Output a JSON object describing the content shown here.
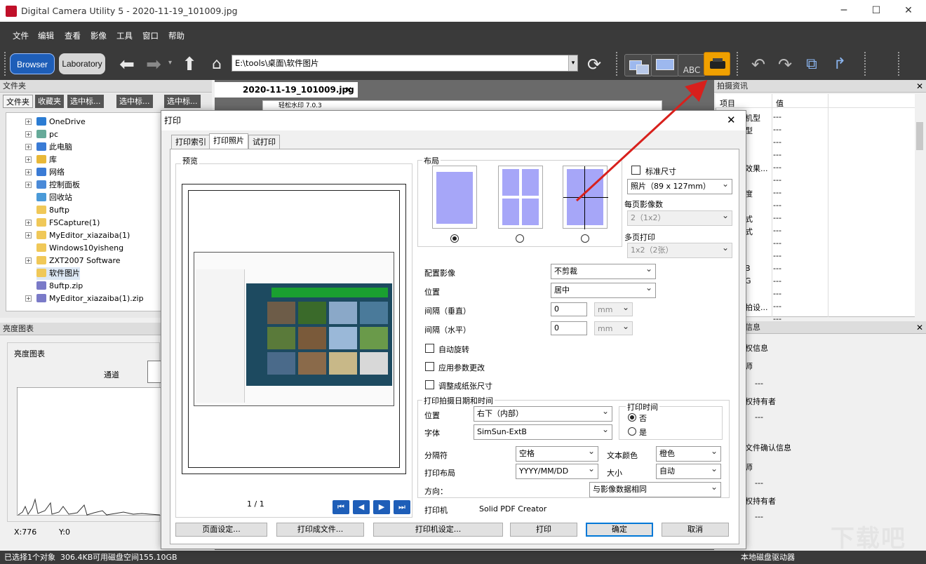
{
  "window": {
    "title": "Digital Camera Utility 5 - 2020-11-19_101009.jpg",
    "min": "─",
    "max": "☐",
    "close": "✕"
  },
  "menu": [
    "文件",
    "编辑",
    "查看",
    "影像",
    "工具",
    "窗口",
    "帮助"
  ],
  "toolbar": {
    "browser": "Browser",
    "laboratory": "Laboratory",
    "path": "E:\\tools\\桌面\\软件图片"
  },
  "left": {
    "folder_panel_title": "文件夹",
    "tabs": [
      "文件夹",
      "收藏夹",
      "选中标...",
      "选中标...",
      "选中标..."
    ],
    "tree": [
      "OneDrive",
      "pc",
      "此电脑",
      "库",
      "网络",
      "控制面板",
      "回收站",
      "8uftp",
      "FSCapture(1)",
      "MyEditor_xiazaiba(1)",
      "Windows10yisheng",
      "ZXT2007 Software",
      "软件图片",
      "8uftp.zip",
      "MyEditor_xiazaiba(1).zip"
    ],
    "brightness_title": "亮度图表",
    "brightness_group": "亮度图表",
    "channel": "通道",
    "x": "X:776",
    "y": "Y:0"
  },
  "doc_tab": "2020-11-19_101009.jpg",
  "background_window": "轻松水印 7.0.3",
  "right": {
    "panel1_title": "拍摄资讯",
    "col_item": "项目",
    "col_value": "值",
    "partial_items": [
      "机型",
      "型",
      "效果...",
      "度",
      "式",
      "式",
      "B",
      "G",
      "拍设..."
    ],
    "dash": "---",
    "panel2_title": "信息",
    "p2_items": [
      "权信息",
      "师",
      "---",
      "权持有者",
      "---",
      "文件确认信息",
      "师",
      "---",
      "权持有者",
      "---"
    ]
  },
  "dialog": {
    "title": "打印",
    "close": "✕",
    "tabs": [
      "打印索引",
      "打印照片",
      "试打印"
    ],
    "preview_label": "预览",
    "page_indicator": "1 / 1",
    "nav": [
      "⏮",
      "◀",
      "▶",
      "⏭"
    ],
    "layout_label": "布局",
    "standard_size": "标准尺寸",
    "photo_size": "照片（89 x 127mm）",
    "per_page_label": "每页影像数",
    "per_page_value": "2（1x2）",
    "multi_page_label": "多页打印",
    "multi_page_value": "1x2（2张）",
    "arrange_label": "配置影像",
    "arrange_value": "不剪裁",
    "position_label": "位置",
    "position_value": "居中",
    "gap_v_label": "间隔（垂直）",
    "gap_h_label": "间隔（水平）",
    "gap_value": "0",
    "unit": "mm",
    "auto_rotate": "自动旋转",
    "apply_params": "应用参数更改",
    "fit_paper": "调整成纸张尺寸",
    "date_group": "打印拍摄日期和时间",
    "date_pos_label": "位置",
    "date_pos_value": "右下（内部）",
    "font_label": "字体",
    "font_value": "SimSun-ExtB",
    "time_group": "打印时间",
    "no": "否",
    "yes": "是",
    "sep_label": "分隔符",
    "sep_value": "空格",
    "text_color_label": "文本颜色",
    "text_color_value": "橙色",
    "print_layout_label": "打印布局",
    "print_layout_value": "YYYY/MM/DD",
    "size_label": "大小",
    "size_value": "自动",
    "direction_label": "方向：",
    "direction_value": "与影像数据相同",
    "printer_label": "打印机",
    "printer_value": "Solid PDF Creator",
    "buttons": {
      "page_setup": "页面设定...",
      "print_to_file": "打印成文件...",
      "printer_setup": "打印机设定...",
      "print": "打印",
      "ok": "确定",
      "cancel": "取消"
    }
  },
  "status": {
    "selected": "已选择1个对象",
    "size": "306.4KB",
    "free": "可用磁盘空间155.10GB",
    "drive": "本地磁盘驱动器"
  },
  "colors": {
    "accent": "#0078d7",
    "layout_fill": "#a6a6f8",
    "arrow": "#d8201c",
    "printer_icon_bg": "#f0a000"
  }
}
